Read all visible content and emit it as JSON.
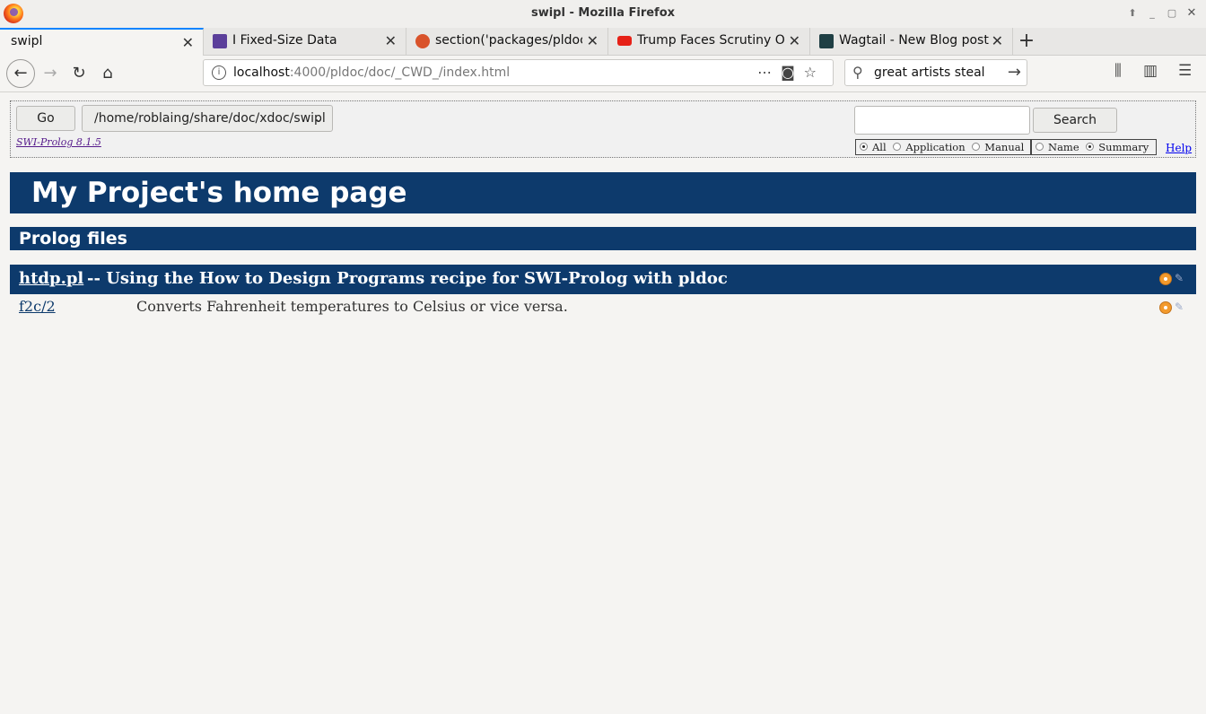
{
  "window": {
    "title": "swipl - Mozilla Firefox"
  },
  "tabs": [
    {
      "label": "swipl",
      "active": true
    },
    {
      "label": "I Fixed-Size Data"
    },
    {
      "label": "section('packages/pldoc.h"
    },
    {
      "label": "Trump Faces Scrutiny Ove"
    },
    {
      "label": "Wagtail - New Blog post"
    }
  ],
  "nav": {
    "url_host": "localhost",
    "url_path": ":4000/pldoc/doc/_CWD_/index.html",
    "search_value": "great artists steal"
  },
  "pldoc_nav": {
    "go_label": "Go",
    "directory": "/home/roblaing/share/doc/xdoc/swipl",
    "version": "SWI-Prolog 8.1.5",
    "search_button": "Search",
    "scope_options": [
      "All",
      "Application",
      "Manual"
    ],
    "scope_selected": "All",
    "match_options": [
      "Name",
      "Summary"
    ],
    "match_selected": "Summary",
    "help": "Help"
  },
  "page": {
    "title": "My Project's home page",
    "section_title": "Prolog files",
    "file": {
      "name": "htdp.pl",
      "description": "-- Using the How to Design Programs recipe for SWI-Prolog with pldoc"
    },
    "predicates": [
      {
        "name": "f2c/2",
        "summary": "Converts Fahrenheit temperatures to Celsius or vice versa."
      }
    ]
  },
  "colors": {
    "header_bg": "#0d3a6c",
    "tab_accent": "#0a84ff",
    "source_icon": "#f39a2c"
  }
}
